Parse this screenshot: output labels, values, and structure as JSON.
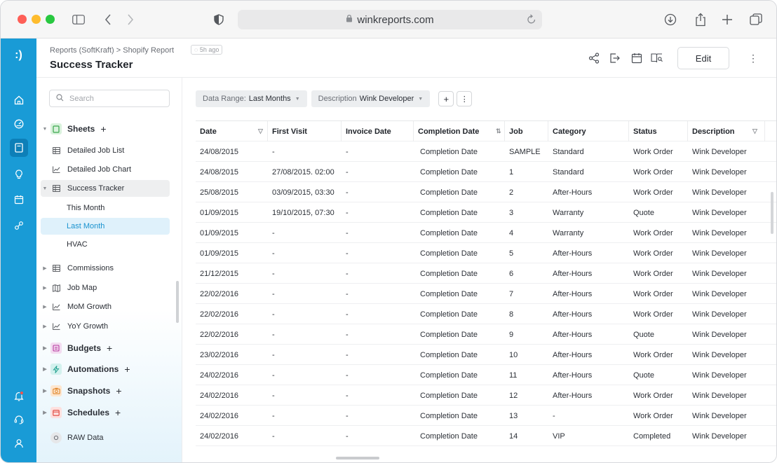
{
  "browser": {
    "url": "winkreports.com"
  },
  "header": {
    "breadcrumb": "Reports (SoftKraft)  >  Shopify Report",
    "updated_badge": "5h ago",
    "title": "Success Tracker",
    "edit_label": "Edit"
  },
  "sidebar": {
    "search_placeholder": "Search",
    "items": [
      {
        "label": "Sheets"
      },
      {
        "label": "Detailed Job List"
      },
      {
        "label": "Detailed Job Chart"
      },
      {
        "label": "Success Tracker"
      },
      {
        "label": "This Month"
      },
      {
        "label": "Last Month"
      },
      {
        "label": "HVAC"
      },
      {
        "label": "Commissions"
      },
      {
        "label": "Job Map"
      },
      {
        "label": "MoM Growth"
      },
      {
        "label": "YoY Growth"
      },
      {
        "label": "Budgets"
      },
      {
        "label": "Automations"
      },
      {
        "label": "Snapshots"
      },
      {
        "label": "Schedules"
      },
      {
        "label": "RAW Data"
      }
    ]
  },
  "filters": {
    "date_range_key": "Data Range:",
    "date_range_value": "Last Months",
    "description_key": "Description",
    "description_value": "Wink Developer"
  },
  "table": {
    "columns": [
      "Date",
      "First Visit",
      "Invoice Date",
      "Completion Date",
      "Job",
      "Category",
      "Status",
      "Description"
    ],
    "rows": [
      [
        "24/08/2015",
        "-",
        "-",
        "Completion Date",
        "SAMPLE",
        "Standard",
        "Work Order",
        "Wink Developer"
      ],
      [
        "24/08/2015",
        "27/08/2015. 02:00",
        "-",
        "Completion Date",
        "1",
        "Standard",
        "Work Order",
        "Wink Developer"
      ],
      [
        "25/08/2015",
        "03/09/2015, 03:30",
        "-",
        "Completion Date",
        "2",
        "After-Hours",
        "Work Order",
        "Wink Developer"
      ],
      [
        "01/09/2015",
        "19/10/2015, 07:30",
        "-",
        "Completion Date",
        "3",
        "Warranty",
        "Quote",
        "Wink Developer"
      ],
      [
        "01/09/2015",
        "-",
        "-",
        "Completion Date",
        "4",
        "Warranty",
        "Work Order",
        "Wink Developer"
      ],
      [
        "01/09/2015",
        "-",
        "-",
        "Completion Date",
        "5",
        "After-Hours",
        "Work Order",
        "Wink Developer"
      ],
      [
        "21/12/2015",
        "-",
        "-",
        "Completion Date",
        "6",
        "After-Hours",
        "Work Order",
        "Wink Developer"
      ],
      [
        "22/02/2016",
        "-",
        "-",
        "Completion Date",
        "7",
        "After-Hours",
        "Work Order",
        "Wink Developer"
      ],
      [
        "22/02/2016",
        "-",
        "-",
        "Completion Date",
        "8",
        "After-Hours",
        "Work Order",
        "Wink Developer"
      ],
      [
        "22/02/2016",
        "-",
        "-",
        "Completion Date",
        "9",
        "After-Hours",
        "Quote",
        "Wink Developer"
      ],
      [
        "23/02/2016",
        "-",
        "-",
        "Completion Date",
        "10",
        "After-Hours",
        "Work Order",
        "Wink Developer"
      ],
      [
        "24/02/2016",
        "-",
        "-",
        "Completion Date",
        "11",
        "After-Hours",
        "Quote",
        "Wink Developer"
      ],
      [
        "24/02/2016",
        "-",
        "-",
        "Completion Date",
        "12",
        "After-Hours",
        "Work Order",
        "Wink Developer"
      ],
      [
        "24/02/2016",
        "-",
        "-",
        "Completion Date",
        "13",
        "-",
        "Work Order",
        "Wink Developer"
      ],
      [
        "24/02/2016",
        "-",
        "-",
        "Completion Date",
        "14",
        "VIP",
        "Completed",
        "Wink Developer"
      ]
    ]
  },
  "colors": {
    "brand": "#199bd6",
    "selected_bg": "#dff1fb",
    "selected_text": "#1a93cf"
  },
  "icons": {
    "rail": [
      "home-icon",
      "dashboard-icon",
      "reports-icon",
      "bulb-icon",
      "calendar-icon",
      "link-icon",
      "notification-icon",
      "support-icon",
      "user-icon"
    ],
    "header": [
      "share-icon",
      "export-icon",
      "calendar-icon",
      "preview-icon",
      "more-icon"
    ]
  }
}
